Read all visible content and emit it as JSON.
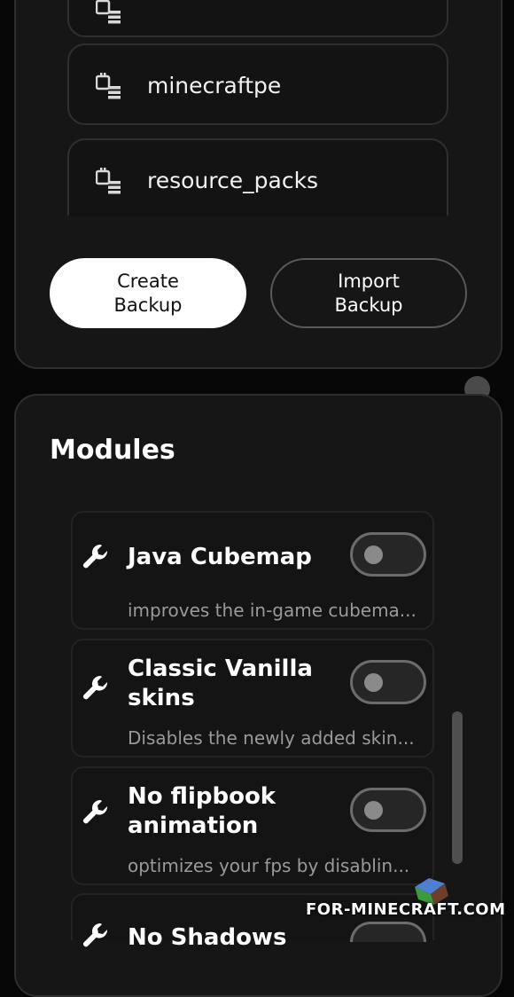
{
  "backups": {
    "folders": [
      {
        "label": ""
      },
      {
        "label": "minecraftpe"
      },
      {
        "label": "resource_packs"
      }
    ],
    "create_label": "Create\nBackup",
    "import_label": "Import\nBackup"
  },
  "modules": {
    "title": "Modules",
    "items": [
      {
        "name": "Java Cubemap",
        "description": "improves the in-game cubema...",
        "enabled": false
      },
      {
        "name": "Classic Vanilla skins",
        "description": "Disables the newly added skin...",
        "enabled": false
      },
      {
        "name": "No flipbook animation",
        "description": "optimizes your fps by disablin...",
        "enabled": false
      },
      {
        "name": "No Shadows",
        "description": "",
        "enabled": false
      }
    ]
  },
  "watermark": "FOR-MINECRAFT.COM",
  "colors": {
    "background": "#070707",
    "card": "#161616",
    "button_primary": "#ffffff",
    "text_muted": "#9a9a9a"
  }
}
